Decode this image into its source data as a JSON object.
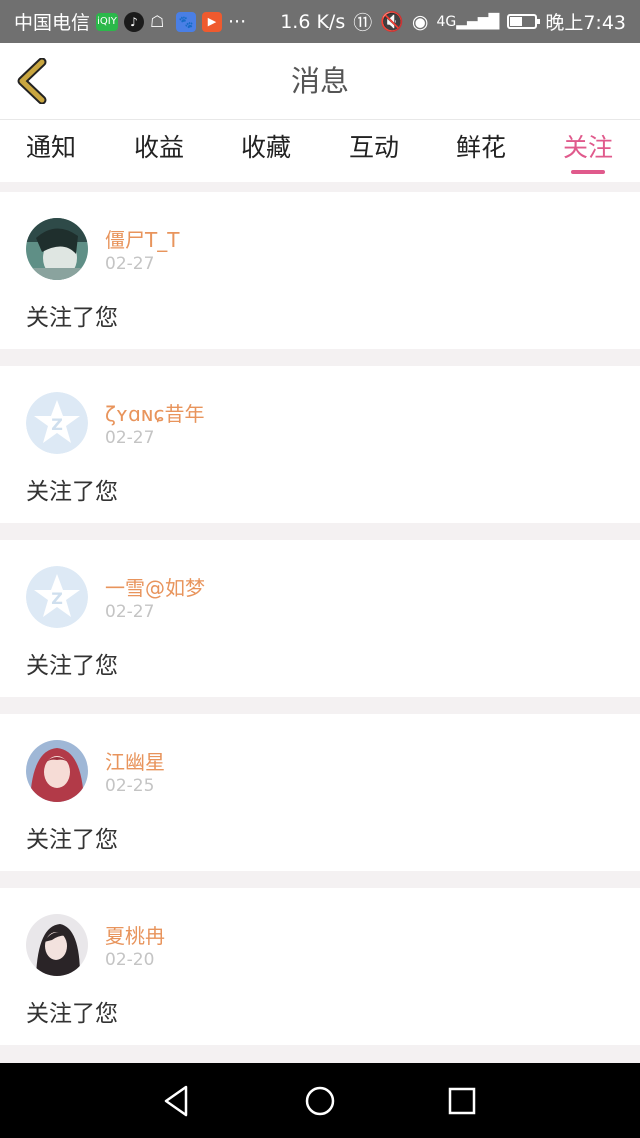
{
  "status_bar": {
    "carrier": "中国电信",
    "speed": "1.6 K/s",
    "time": "晚上7:43",
    "app_icons": [
      "iqiyi-icon",
      "tiktok-icon",
      "qq-icon",
      "baidu-icon",
      "video-play-icon"
    ],
    "more": "···",
    "battery_level": 0.5
  },
  "header": {
    "title": "消息",
    "back_icon": "chevron-left-icon",
    "back_color": "#c9a640"
  },
  "tabs": [
    {
      "label": "通知",
      "active": false
    },
    {
      "label": "收益",
      "active": false
    },
    {
      "label": "收藏",
      "active": false
    },
    {
      "label": "互动",
      "active": false
    },
    {
      "label": "鲜花",
      "active": false
    },
    {
      "label": "关注",
      "active": true
    }
  ],
  "accent_color": "#e05a8c",
  "name_color": "#e8945c",
  "messages": [
    {
      "name": "僵尸T_T",
      "date": "02-27",
      "text": "关注了您",
      "avatar": "photo"
    },
    {
      "name": "ζʏɑɴɕ昔年",
      "date": "02-27",
      "text": "关注了您",
      "avatar": "default-qzone"
    },
    {
      "name": "一雪@如梦",
      "date": "02-27",
      "text": "关注了您",
      "avatar": "default-qzone"
    },
    {
      "name": "江幽星",
      "date": "02-25",
      "text": "关注了您",
      "avatar": "photo"
    },
    {
      "name": "夏桃冉",
      "date": "02-20",
      "text": "关注了您",
      "avatar": "photo"
    }
  ],
  "nav_bar": {
    "back": "triangle-back-icon",
    "home": "circle-home-icon",
    "recents": "square-recents-icon"
  }
}
